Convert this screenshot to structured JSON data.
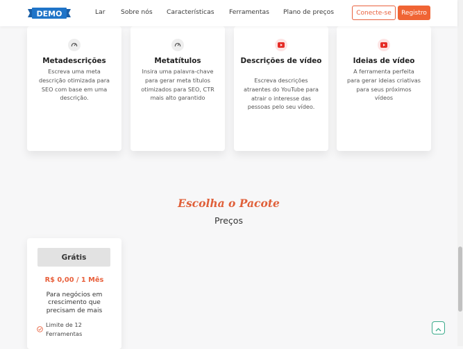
{
  "header": {
    "logo_text": "DEMO",
    "nav": [
      "Lar",
      "Sobre nós",
      "Características",
      "Ferramentas",
      "Plano de preços"
    ],
    "login_label": "Conecte-se",
    "register_label": "Registro"
  },
  "tools": [
    {
      "icon": "gauge-icon",
      "title": "Metadescrições",
      "description": "Escreva uma meta descrição otimizada para SEO com base em uma descrição."
    },
    {
      "icon": "gauge-icon",
      "title": "Metatítulos",
      "description": "Insira uma palavra-chave para gerar meta títulos otimizados para SEO, CTR mais alto garantido"
    },
    {
      "icon": "youtube-icon",
      "title": "Descrições de vídeo",
      "description": "Escreva descrições atraentes do YouTube para atrair o interesse das pessoas pelo seu vídeo."
    },
    {
      "icon": "youtube-icon",
      "title": "Ideias de vídeo",
      "description": "A ferramenta perfeita para gerar ideias criativas para seus próximos vídeos"
    }
  ],
  "pricing": {
    "heading": "Escolha o Pacote",
    "subheading": "Preços",
    "plans": [
      {
        "name": "Grátis",
        "price": "R$ 0,00 / 1 Mês",
        "description": "Para negócios em crescimento que precisam de mais",
        "features": [
          "Limite de 12 Ferramentas"
        ]
      }
    ]
  },
  "colors": {
    "accent": "#f06434",
    "heading_script": "#e0603a",
    "logo_blue": "#1a6fc2"
  }
}
